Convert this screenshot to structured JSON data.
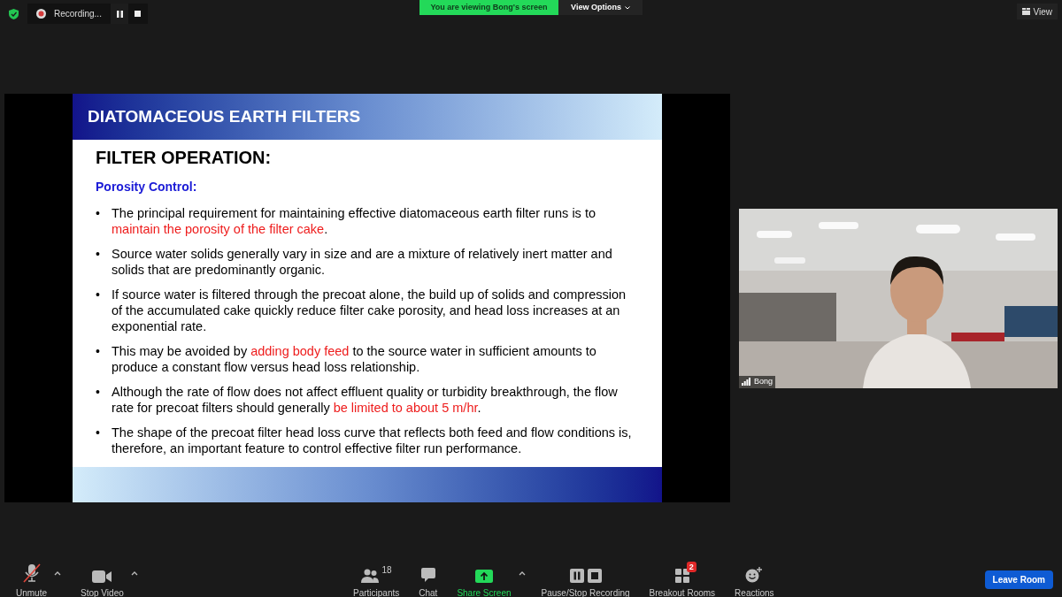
{
  "top_bar": {
    "recording": {
      "label": "Recording..."
    },
    "banner": "You are viewing Bong's screen",
    "view_options": "View Options",
    "view": "View"
  },
  "slide": {
    "title": "DIATOMACEOUS EARTH FILTERS",
    "heading": "FILTER OPERATION:",
    "subheading": "Porosity Control:",
    "bullet": "•",
    "bullets": [
      {
        "parts": [
          {
            "text": "The principal requirement for maintaining effective diatomaceous earth filter runs is to ",
            "highlight": false
          },
          {
            "text": "maintain the porosity of the filter cake",
            "highlight": true
          },
          {
            "text": ".",
            "highlight": false
          }
        ]
      },
      {
        "parts": [
          {
            "text": "Source water solids generally vary in size and are a mixture of relatively inert matter and solids that are predominantly organic.",
            "highlight": false
          }
        ]
      },
      {
        "parts": [
          {
            "text": "If source water is filtered through the precoat alone, the build up of solids and compression of the accumulated cake quickly reduce filter cake porosity, and head loss increases at an exponential rate.",
            "highlight": false
          }
        ]
      },
      {
        "parts": [
          {
            "text": "This may be avoided by ",
            "highlight": false
          },
          {
            "text": "adding body feed",
            "highlight": true
          },
          {
            "text": " to the source water in sufficient amounts to produce a constant flow versus head loss relationship.",
            "highlight": false
          }
        ]
      },
      {
        "parts": [
          {
            "text": "Although the rate of flow does not affect effluent quality or turbidity breakthrough, the flow rate for precoat filters should generally ",
            "highlight": false
          },
          {
            "text": "be limited to about 5 m/hr",
            "highlight": true
          },
          {
            "text": ".",
            "highlight": false
          }
        ]
      },
      {
        "parts": [
          {
            "text": "The shape of the precoat filter head loss curve that reflects both feed and flow conditions is, therefore, an important feature to control effective filter run performance.",
            "highlight": false
          }
        ]
      }
    ]
  },
  "video_tile": {
    "name": "Bong"
  },
  "toolbar": [
    {
      "kind": "audio",
      "label": "Unmute",
      "muted": true,
      "caret": true
    },
    {
      "kind": "video",
      "label": "Stop Video",
      "muted": false,
      "caret": true
    },
    {
      "kind": "participants",
      "label": "Participants",
      "count": "18"
    },
    {
      "kind": "chat",
      "label": "Chat"
    },
    {
      "kind": "share",
      "label": "Share Screen",
      "caret": true
    },
    {
      "kind": "recording",
      "label": "Pause/Stop Recording"
    },
    {
      "kind": "breakout",
      "label": "Breakout Rooms",
      "badge": "2"
    },
    {
      "kind": "reactions",
      "label": "Reactions"
    }
  ],
  "leave_button": "Leave Room"
}
